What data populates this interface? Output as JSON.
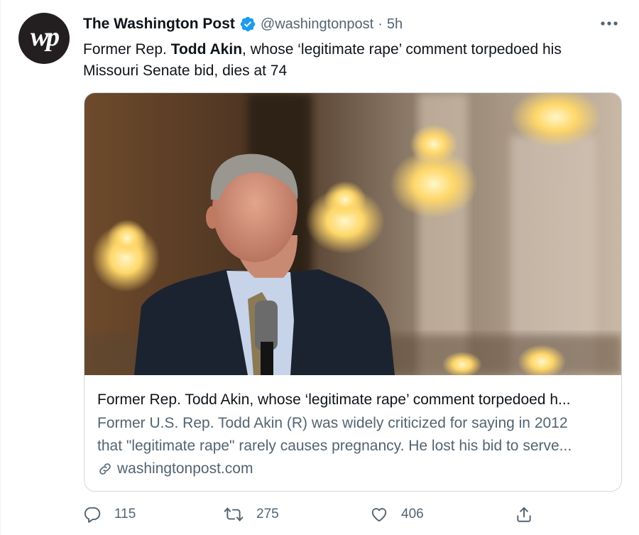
{
  "tweet": {
    "author_name": "The Washington Post",
    "avatar_mark": "wp",
    "handle": "@washingtonpost",
    "separator": "·",
    "time": "5h",
    "text_prefix": "Former Rep. ",
    "text_bold": "Todd Akin",
    "text_line1_rest": ", whose ‘legitimate rape’ comment torpedoed his",
    "text_line2": "Missouri Senate bid, dies at 74"
  },
  "card": {
    "title": "Former Rep. Todd Akin, whose ‘legitimate rape’ comment torpedoed h...",
    "description_line1": "Former U.S. Rep. Todd Akin (R) was widely criticized for saying in 2012",
    "description_line2": "that \"legitimate rape\" rarely causes pregnancy. He lost his bid to serve...",
    "domain": "washingtonpost.com"
  },
  "actions": {
    "replies": "115",
    "retweets": "275",
    "likes": "406"
  },
  "colors": {
    "verified_blue": "#1d9bf0",
    "secondary_text": "#536471",
    "primary_text": "#0f1419",
    "border": "#cfd9de"
  },
  "icons": [
    "verified-badge-icon",
    "more-options-icon",
    "link-icon",
    "reply-icon",
    "retweet-icon",
    "like-icon",
    "share-icon"
  ]
}
